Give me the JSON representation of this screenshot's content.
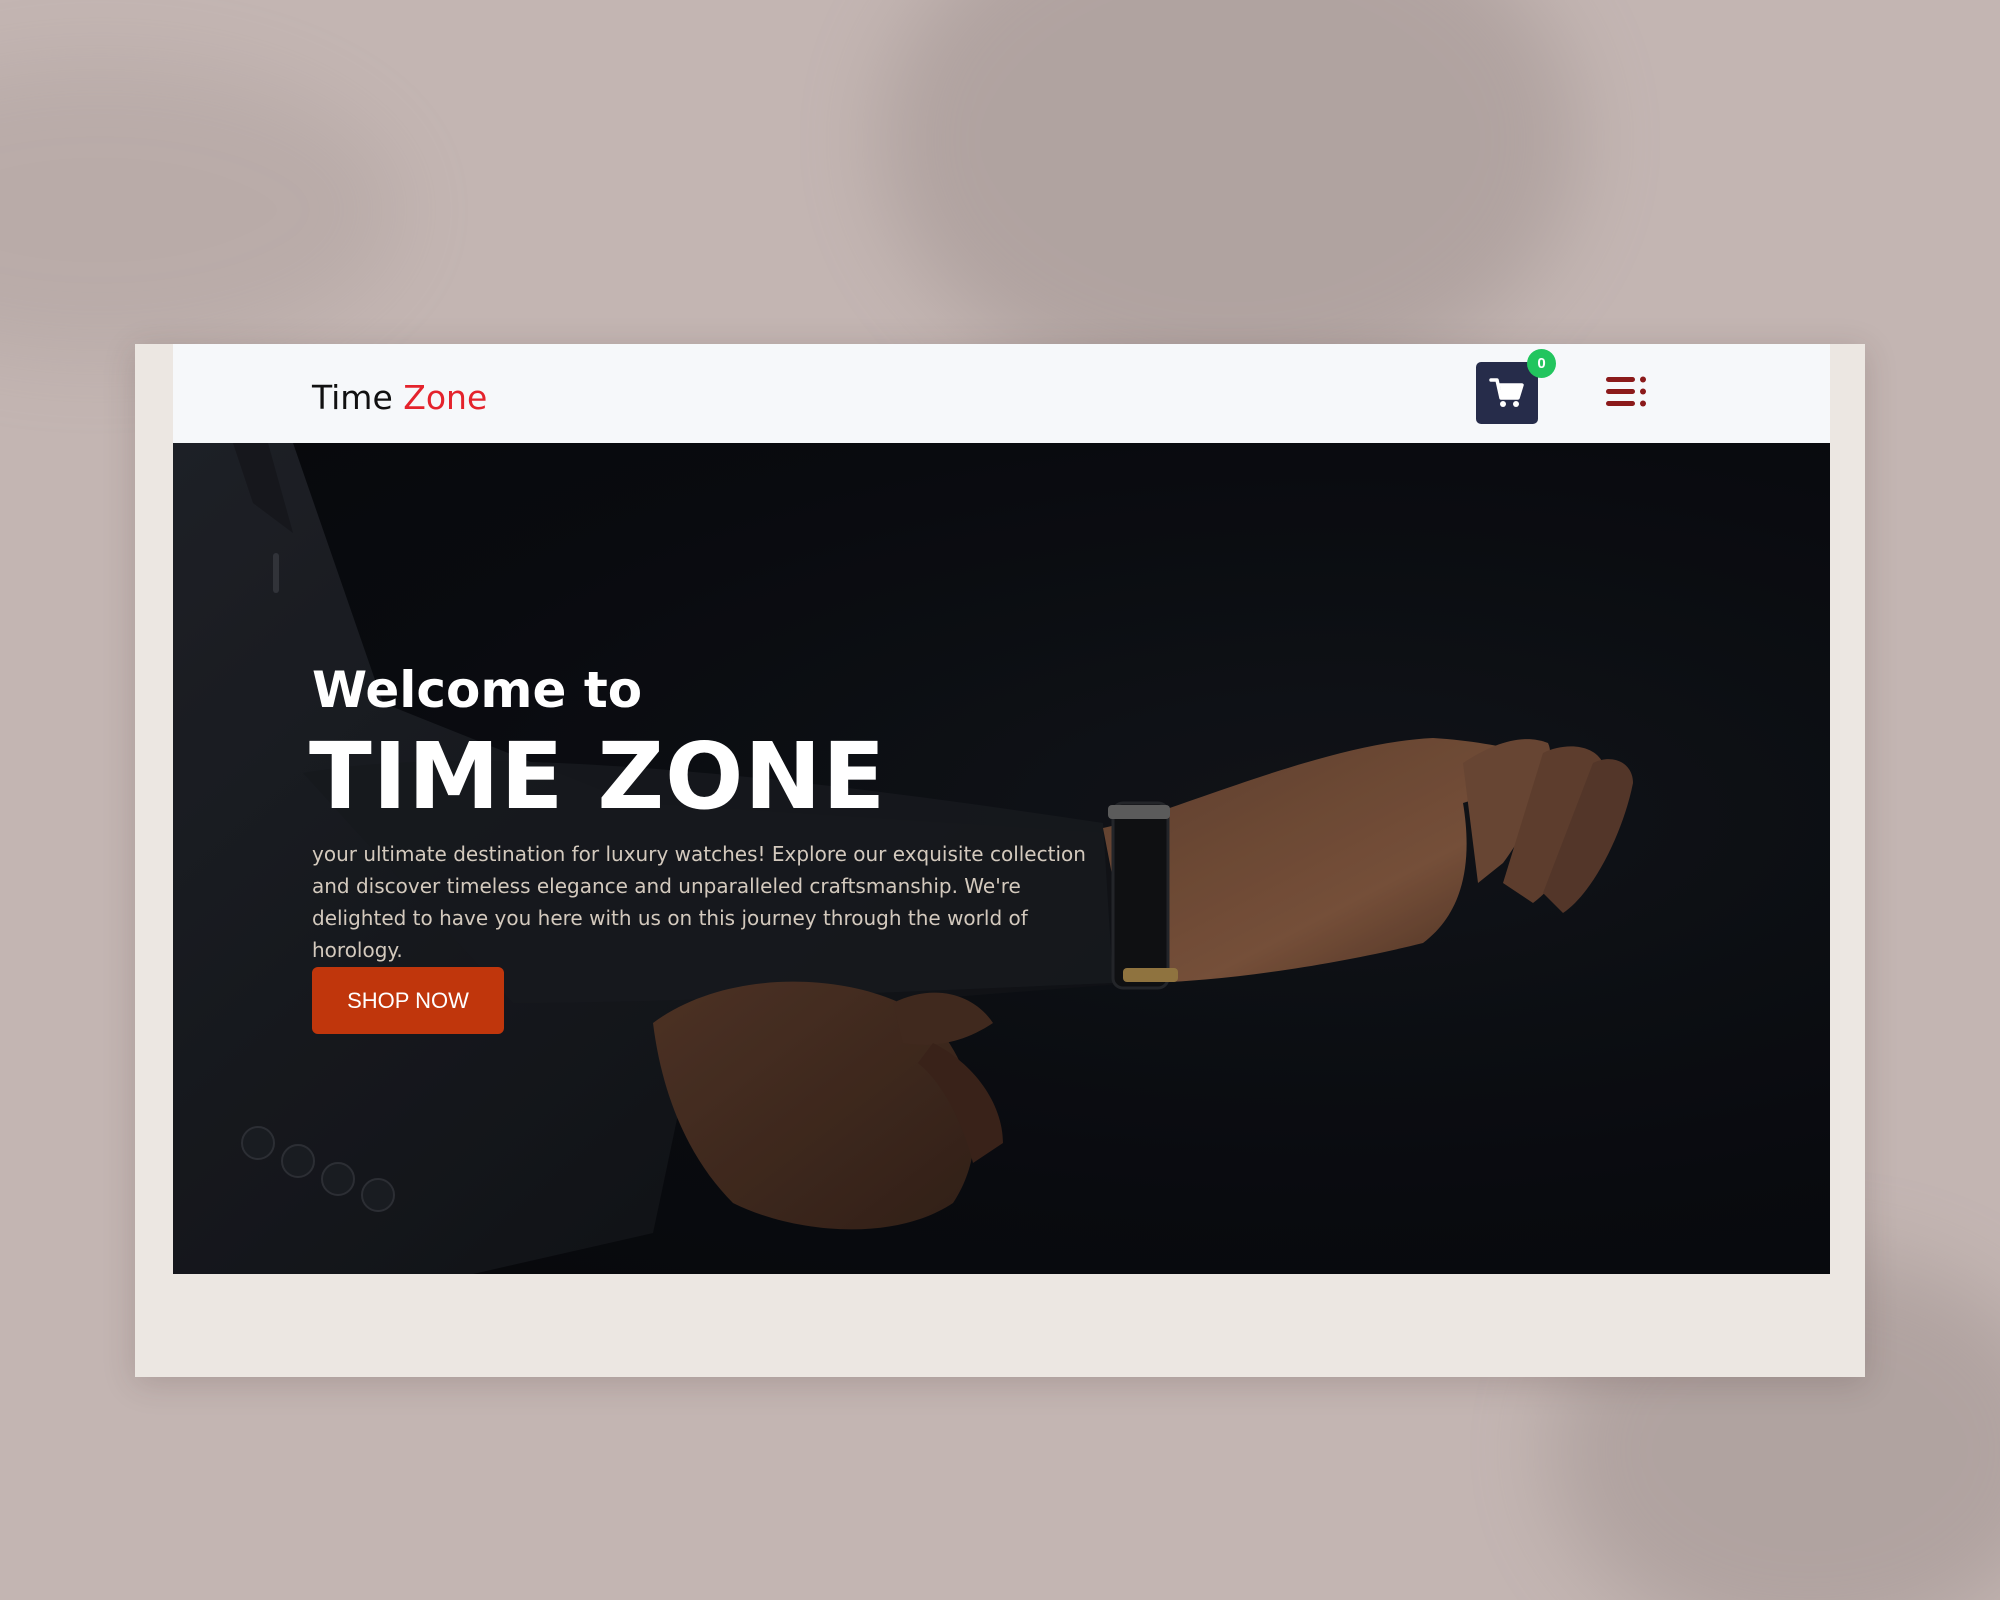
{
  "header": {
    "logo_part1": "Time ",
    "logo_part2": "Zone",
    "cart_count": "0",
    "cart_icon": "shopping-cart-icon",
    "menu_icon": "menu-icon"
  },
  "hero": {
    "welcome": "Welcome to",
    "brand": "TIME ZONE",
    "tagline": "your ultimate destination for luxury watches! Explore our exquisite collection and discover timeless elegance and unparalleled craftsmanship. We're delighted to have you here with us on this journey through the world of horology.",
    "cta_label": "SHOP NOW"
  },
  "colors": {
    "navbar_bg": "#f6f8fa",
    "logo_accent": "#e4232c",
    "cart_bg": "#262c4a",
    "badge_bg": "#22c55e",
    "menu_icon": "#8b1a1a",
    "cta_bg": "#c0360c",
    "hero_bg": "#0b0d12",
    "tagline": "#d3c9bd"
  }
}
